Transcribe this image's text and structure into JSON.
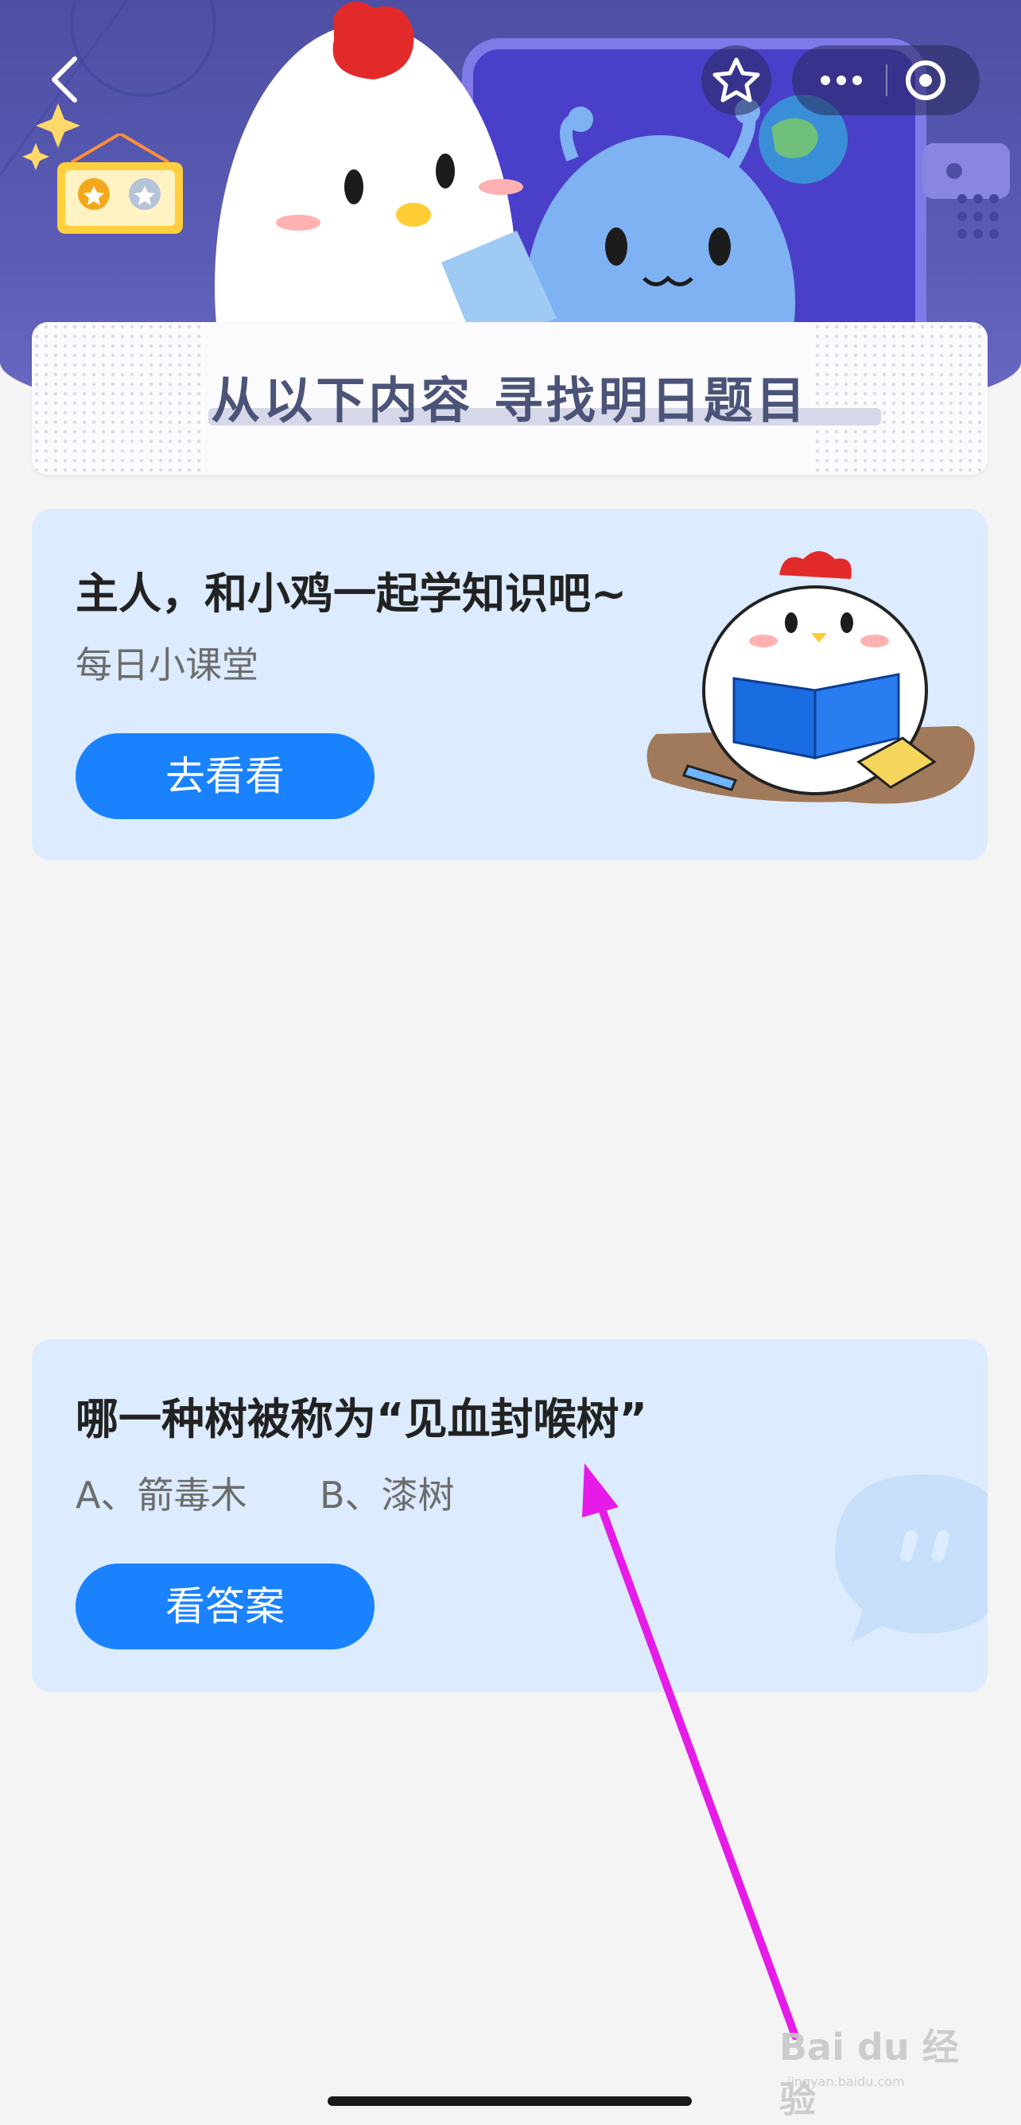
{
  "header": {
    "back_icon": "chevron-left-icon",
    "star_icon": "star-icon",
    "more_icon": "more-dots-icon",
    "target_icon": "target-circle-icon",
    "badge_icon": "medal-frame-icon"
  },
  "banner": {
    "title": "从以下内容  寻找明日题目"
  },
  "lesson_card": {
    "title": "主人，和小鸡一起学知识吧~",
    "subtitle": "每日小课堂",
    "button_label": "去看看"
  },
  "question_card": {
    "question": "哪一种树被称为“见血封喉树”",
    "option_a": "A、箭毒木",
    "option_b": "B、漆树",
    "button_label": "看答案"
  },
  "watermark": {
    "text": "Bai du 经验",
    "url": "jingyan.baidu.com"
  },
  "colors": {
    "hero": "#5a5cb6",
    "card": "#dcebfd",
    "button": "#1a82ff",
    "arrow": "#e61be8"
  }
}
